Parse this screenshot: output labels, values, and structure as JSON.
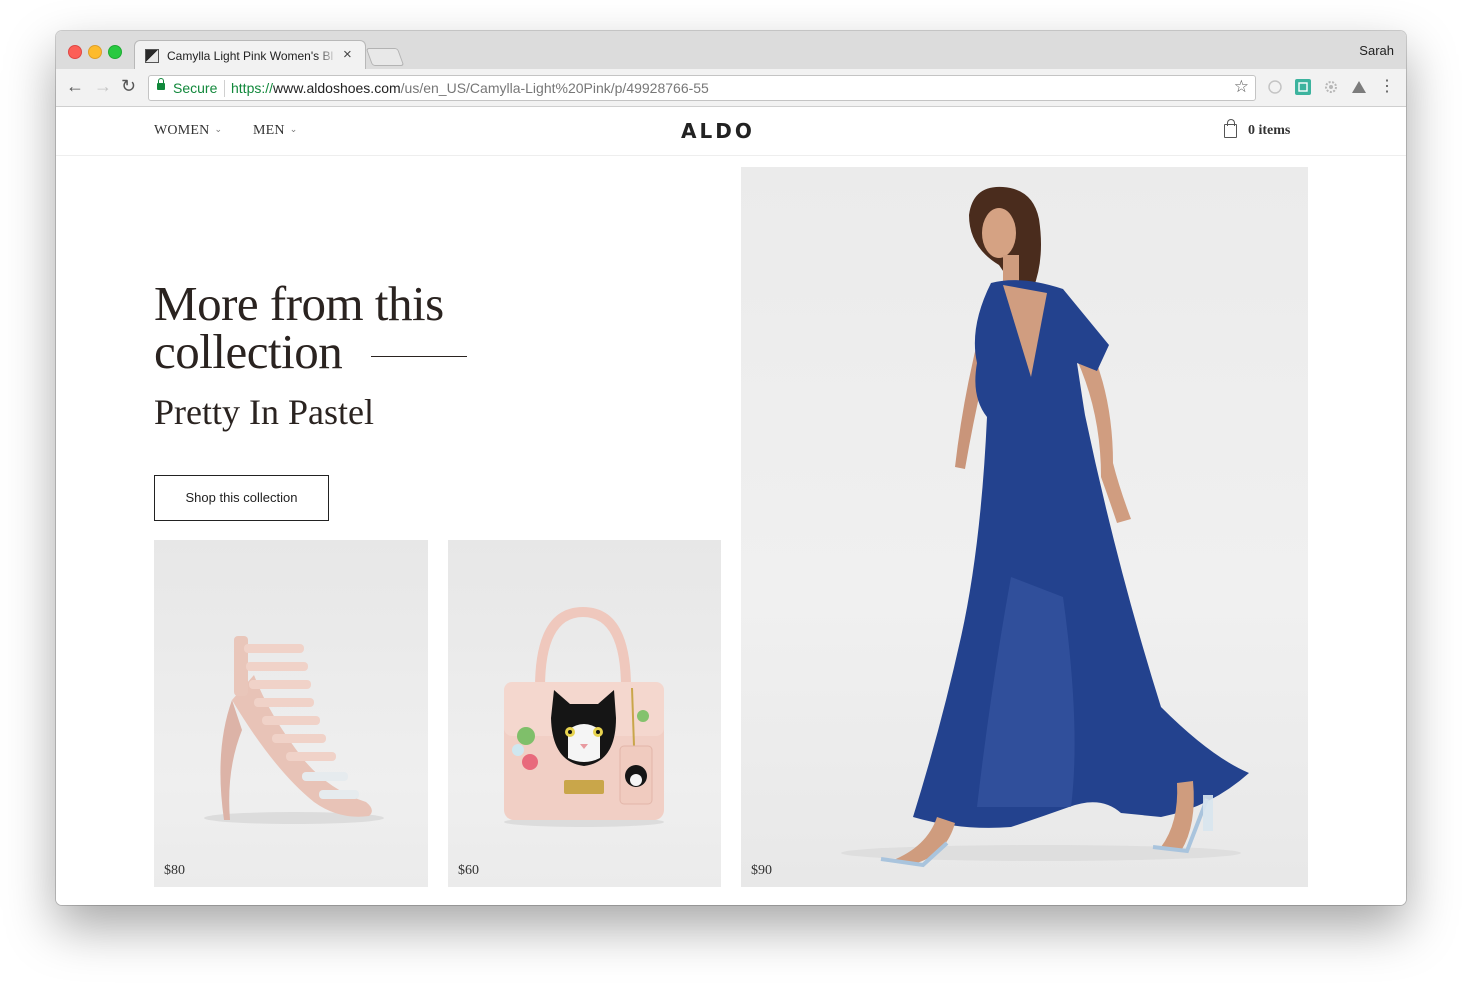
{
  "browser": {
    "tab_title": "Camylla Light Pink Women's Bl",
    "tab_close": "×",
    "profile": "Sarah",
    "back_glyph": "←",
    "forward_glyph": "→",
    "reload_glyph": "↻",
    "secure_label": "Secure",
    "url_proto": "https://",
    "url_host": "www.aldoshoes.com",
    "url_path": "/us/en_US/Camylla-Light%20Pink/p/49928766-55",
    "star_glyph": "☆",
    "menu_glyph": "⋮"
  },
  "site": {
    "logo": "ALDO",
    "nav": [
      {
        "label": "WOMEN"
      },
      {
        "label": "MEN"
      }
    ],
    "caret_glyph": "⌄",
    "cart_label": "0 items"
  },
  "collection": {
    "headline_line1": "More from this",
    "headline_line2": "collection",
    "name": "Pretty In Pastel",
    "cta": "Shop this collection"
  },
  "products": [
    {
      "price": "$80",
      "kind": "pink strappy stiletto sandal"
    },
    {
      "price": "$60",
      "kind": "pink cat handbag"
    },
    {
      "price": "$90",
      "kind": "model in blue wrap maxi dress"
    }
  ],
  "colors": {
    "secure_green": "#11883b",
    "dress_blue": "#23428e",
    "blush_pink": "#f1cfc5",
    "headline": "#2a2320"
  }
}
